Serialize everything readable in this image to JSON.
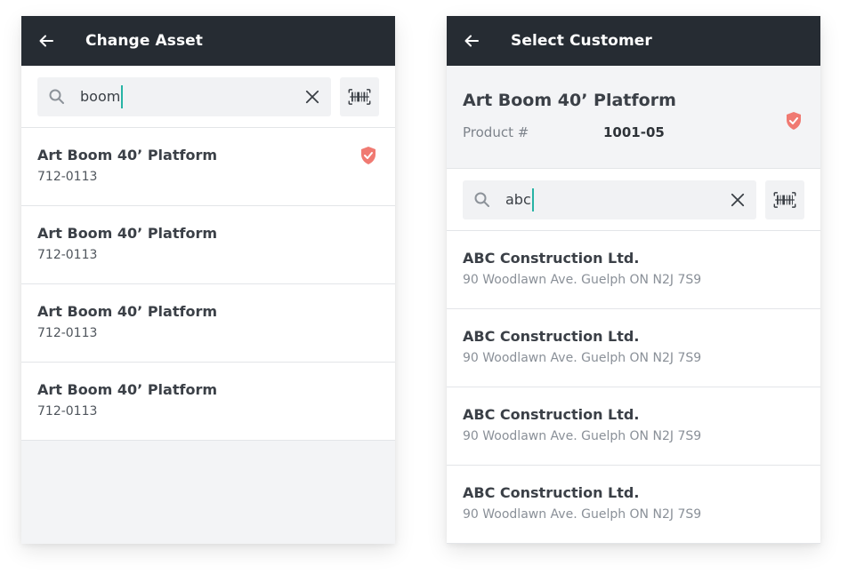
{
  "left_panel": {
    "title": "Change Asset",
    "search": {
      "value": "boom"
    },
    "items": [
      {
        "title": "Art Boom 40’ Platform",
        "code": "712-0113",
        "verified": true
      },
      {
        "title": "Art Boom 40’ Platform",
        "code": "712-0113",
        "verified": false
      },
      {
        "title": "Art Boom 40’ Platform",
        "code": "712-0113",
        "verified": false
      },
      {
        "title": "Art Boom 40’ Platform",
        "code": "712-0113",
        "verified": false
      }
    ]
  },
  "right_panel": {
    "title": "Select Customer",
    "product": {
      "name": "Art Boom 40’ Platform",
      "label": "Product #",
      "number": "1001-05",
      "verified": true
    },
    "search": {
      "value": "abc"
    },
    "items": [
      {
        "name": "ABC Construction Ltd.",
        "address": "90 Woodlawn Ave. Guelph ON N2J 7S9"
      },
      {
        "name": "ABC Construction Ltd.",
        "address": "90 Woodlawn Ave. Guelph ON N2J 7S9"
      },
      {
        "name": "ABC Construction Ltd.",
        "address": "90 Woodlawn Ave. Guelph ON N2J 7S9"
      },
      {
        "name": "ABC Construction Ltd.",
        "address": "90 Woodlawn Ave. Guelph ON N2J 7S9"
      }
    ]
  },
  "colors": {
    "appbar": "#262c33",
    "accent_caret": "#27b4a5",
    "shield": "#f07a72"
  },
  "icons": [
    "back-arrow-icon",
    "search-icon",
    "close-icon",
    "barcode-icon",
    "shield-check-icon"
  ]
}
